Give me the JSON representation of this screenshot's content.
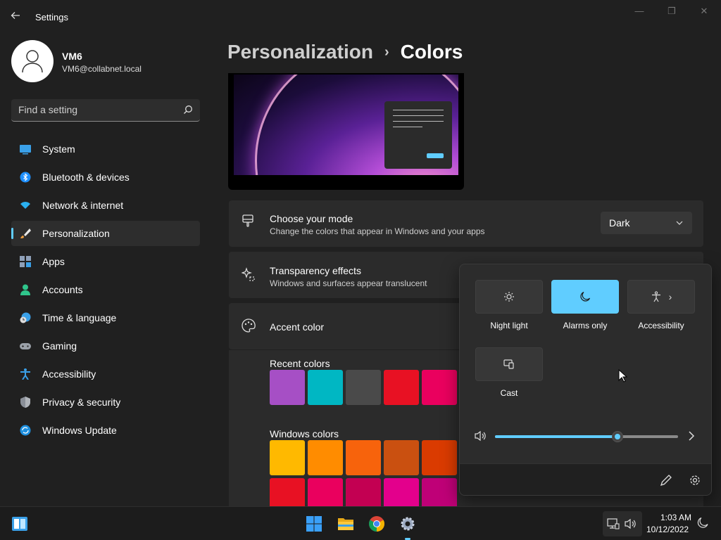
{
  "window": {
    "title": "Settings",
    "minimize": "—",
    "maximize": "❐",
    "close": "✕"
  },
  "user": {
    "name": "VM6",
    "email": "VM6@collabnet.local"
  },
  "search": {
    "placeholder": "Find a setting"
  },
  "sidebar": {
    "items": [
      {
        "label": "System",
        "icon": "system-icon",
        "color": "#3aa0e8"
      },
      {
        "label": "Bluetooth & devices",
        "icon": "bluetooth-icon",
        "color": "#1e90ff"
      },
      {
        "label": "Network & internet",
        "icon": "wifi-icon",
        "color": "#2ab0f0"
      },
      {
        "label": "Personalization",
        "icon": "brush-icon",
        "color": "#f0a040",
        "active": true
      },
      {
        "label": "Apps",
        "icon": "apps-icon",
        "color": "#8fa0b8"
      },
      {
        "label": "Accounts",
        "icon": "accounts-icon",
        "color": "#2fc58b"
      },
      {
        "label": "Time & language",
        "icon": "clock-globe-icon",
        "color": "#3aa0e8"
      },
      {
        "label": "Gaming",
        "icon": "gamepad-icon",
        "color": "#9aa0a8"
      },
      {
        "label": "Accessibility",
        "icon": "accessibility-icon",
        "color": "#3aa0e8"
      },
      {
        "label": "Privacy & security",
        "icon": "shield-icon",
        "color": "#8a8f98"
      },
      {
        "label": "Windows Update",
        "icon": "update-icon",
        "color": "#1e90e0"
      }
    ]
  },
  "breadcrumb": {
    "parent": "Personalization",
    "separator": "›",
    "current": "Colors"
  },
  "mode_card": {
    "title": "Choose your mode",
    "subtitle": "Change the colors that appear in Windows and your apps",
    "value": "Dark"
  },
  "transparency_card": {
    "title": "Transparency effects",
    "subtitle": "Windows and surfaces appear translucent"
  },
  "accent_card": {
    "title": "Accent color"
  },
  "recent_colors": {
    "label": "Recent colors",
    "colors": [
      "#a64fc5",
      "#00b7c3",
      "#4a4a4a",
      "#e81123",
      "#ea005e"
    ]
  },
  "windows_colors": {
    "label": "Windows colors",
    "row1": [
      "#ffb900",
      "#ff8c00",
      "#f7630c",
      "#ca5010",
      "#da3b01"
    ],
    "row2": [
      "#e81123",
      "#ea005e",
      "#c30052",
      "#e3008c",
      "#bf0077"
    ]
  },
  "quick_settings": {
    "tiles": [
      {
        "label": "Night light",
        "icon": "brightness-icon",
        "on": false
      },
      {
        "label": "Alarms only",
        "icon": "moon-icon",
        "on": true
      },
      {
        "label": "Accessibility",
        "icon": "accessibility-icon",
        "chevron": "›",
        "on": false
      },
      {
        "label": "Cast",
        "icon": "cast-icon",
        "on": false
      }
    ],
    "volume": 67
  },
  "taskbar": {
    "time": "1:03 AM",
    "date": "10/12/2022"
  },
  "colors": {
    "accent": "#60cdff",
    "background": "#202020",
    "card": "#2b2b2b"
  }
}
